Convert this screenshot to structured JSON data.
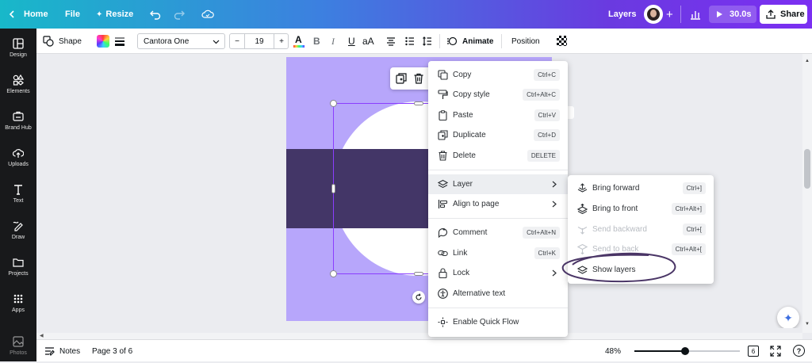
{
  "topbar": {
    "home": "Home",
    "file": "File",
    "resize": "Resize",
    "layers": "Layers",
    "play_time": "30.0s",
    "share": "Share"
  },
  "sidebar": {
    "items": [
      {
        "label": "Design",
        "icon": "design-icon"
      },
      {
        "label": "Elements",
        "icon": "elements-icon"
      },
      {
        "label": "Brand Hub",
        "icon": "brand-hub-icon"
      },
      {
        "label": "Uploads",
        "icon": "upload-icon"
      },
      {
        "label": "Text",
        "icon": "text-icon"
      },
      {
        "label": "Draw",
        "icon": "draw-icon"
      },
      {
        "label": "Projects",
        "icon": "folder-icon"
      },
      {
        "label": "Apps",
        "icon": "apps-icon"
      },
      {
        "label": "Photos",
        "icon": "photos-icon"
      }
    ]
  },
  "toolbar": {
    "shape": "Shape",
    "font": "Cantora One",
    "font_size": "19",
    "minus": "−",
    "plus": "+",
    "bold": "B",
    "italic": "I",
    "underline": "U",
    "case": "aA",
    "animate": "Animate",
    "position": "Position"
  },
  "context_menu": {
    "items": [
      {
        "label": "Copy",
        "shortcut": "Ctrl+C"
      },
      {
        "label": "Copy style",
        "shortcut": "Ctrl+Alt+C"
      },
      {
        "label": "Paste",
        "shortcut": "Ctrl+V"
      },
      {
        "label": "Duplicate",
        "shortcut": "Ctrl+D"
      },
      {
        "label": "Delete",
        "shortcut": "DELETE"
      },
      {
        "label": "Layer"
      },
      {
        "label": "Align to page"
      },
      {
        "label": "Comment",
        "shortcut": "Ctrl+Alt+N"
      },
      {
        "label": "Link",
        "shortcut": "Ctrl+K"
      },
      {
        "label": "Lock"
      },
      {
        "label": "Alternative text"
      },
      {
        "label": "Enable Quick Flow"
      }
    ]
  },
  "layer_submenu": {
    "items": [
      {
        "label": "Bring forward",
        "shortcut": "Ctrl+]"
      },
      {
        "label": "Bring to front",
        "shortcut": "Ctrl+Alt+]"
      },
      {
        "label": "Send backward",
        "shortcut": "Ctrl+["
      },
      {
        "label": "Send to back",
        "shortcut": "Ctrl+Alt+["
      },
      {
        "label": "Show layers"
      }
    ]
  },
  "bottombar": {
    "notes": "Notes",
    "page": "Page 3 of 6",
    "zoom": "48%",
    "zoom_level": 0.48,
    "pages_count": "6"
  },
  "colors": {
    "canvas_bg": "#b7a6fb",
    "band": "#433667",
    "selection": "#8b3dff",
    "annotation_ring": "#4a3566"
  }
}
